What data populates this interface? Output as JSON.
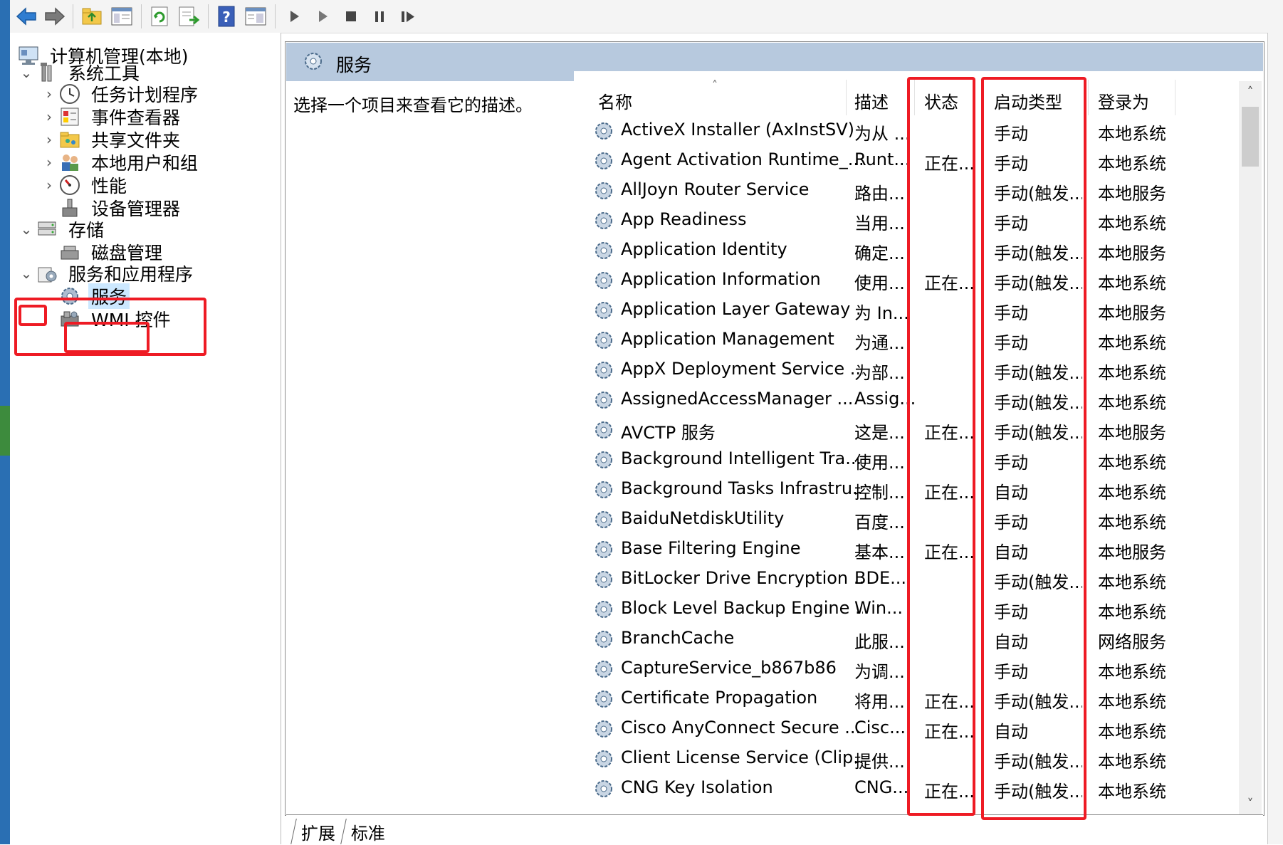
{
  "toolbar": {
    "buttons": [
      "back",
      "forward",
      "up-folder",
      "show-hide-tree",
      "refresh",
      "export-list",
      "help",
      "properties",
      "start-service",
      "start-service-alt",
      "stop-service",
      "pause-service",
      "resume-service"
    ]
  },
  "tree": {
    "root": "计算机管理(本地)",
    "system_tools": "系统工具",
    "task_scheduler": "任务计划程序",
    "event_viewer": "事件查看器",
    "shared_folders": "共享文件夹",
    "local_users": "本地用户和组",
    "performance": "性能",
    "device_manager": "设备管理器",
    "storage": "存储",
    "disk_management": "磁盘管理",
    "services_apps": "服务和应用程序",
    "services": "服务",
    "wmi": "WMI 控件"
  },
  "main": {
    "title": "服务",
    "description_hint": "选择一个项目来查看它的描述。",
    "columns": {
      "name": "名称",
      "description": "描述",
      "status": "状态",
      "startup_type": "启动类型",
      "logon_as": "登录为"
    },
    "rows": [
      {
        "name": "ActiveX Installer (AxInstSV)",
        "desc": "为从 ...",
        "status": "",
        "startup": "手动",
        "logon": "本地系统"
      },
      {
        "name": "Agent Activation Runtime_...",
        "desc": "Runt...",
        "status": "正在...",
        "startup": "手动",
        "logon": "本地系统"
      },
      {
        "name": "AllJoyn Router Service",
        "desc": "路由...",
        "status": "",
        "startup": "手动(触发...",
        "logon": "本地服务"
      },
      {
        "name": "App Readiness",
        "desc": "当用...",
        "status": "",
        "startup": "手动",
        "logon": "本地系统"
      },
      {
        "name": "Application Identity",
        "desc": "确定...",
        "status": "",
        "startup": "手动(触发...",
        "logon": "本地服务"
      },
      {
        "name": "Application Information",
        "desc": "使用...",
        "status": "正在...",
        "startup": "手动(触发...",
        "logon": "本地系统"
      },
      {
        "name": "Application Layer Gateway ...",
        "desc": "为 In...",
        "status": "",
        "startup": "手动",
        "logon": "本地服务"
      },
      {
        "name": "Application Management",
        "desc": "为通...",
        "status": "",
        "startup": "手动",
        "logon": "本地系统"
      },
      {
        "name": "AppX Deployment Service ...",
        "desc": "为部...",
        "status": "",
        "startup": "手动(触发...",
        "logon": "本地系统"
      },
      {
        "name": "AssignedAccessManager ...",
        "desc": "Assig...",
        "status": "",
        "startup": "手动(触发...",
        "logon": "本地系统"
      },
      {
        "name": "AVCTP 服务",
        "desc": "这是...",
        "status": "正在...",
        "startup": "手动(触发...",
        "logon": "本地服务"
      },
      {
        "name": "Background Intelligent Tra...",
        "desc": "使用...",
        "status": "",
        "startup": "手动",
        "logon": "本地系统"
      },
      {
        "name": "Background Tasks Infrastru...",
        "desc": "控制...",
        "status": "正在...",
        "startup": "自动",
        "logon": "本地系统"
      },
      {
        "name": "BaiduNetdiskUtility",
        "desc": "百度...",
        "status": "",
        "startup": "手动",
        "logon": "本地系统"
      },
      {
        "name": "Base Filtering Engine",
        "desc": "基本...",
        "status": "正在...",
        "startup": "自动",
        "logon": "本地服务"
      },
      {
        "name": "BitLocker Drive Encryption ...",
        "desc": "BDE...",
        "status": "",
        "startup": "手动(触发...",
        "logon": "本地系统"
      },
      {
        "name": "Block Level Backup Engine ...",
        "desc": "Win...",
        "status": "",
        "startup": "手动",
        "logon": "本地系统"
      },
      {
        "name": "BranchCache",
        "desc": "此服...",
        "status": "",
        "startup": "自动",
        "logon": "网络服务"
      },
      {
        "name": "CaptureService_b867b86",
        "desc": "为调...",
        "status": "",
        "startup": "手动",
        "logon": "本地系统"
      },
      {
        "name": "Certificate Propagation",
        "desc": "将用...",
        "status": "正在...",
        "startup": "手动(触发...",
        "logon": "本地系统"
      },
      {
        "name": "Cisco AnyConnect Secure ...",
        "desc": "Cisc...",
        "status": "正在...",
        "startup": "自动",
        "logon": "本地系统"
      },
      {
        "name": "Client License Service (Clip...",
        "desc": "提供...",
        "status": "",
        "startup": "手动(触发...",
        "logon": "本地系统"
      },
      {
        "name": "CNG Key Isolation",
        "desc": "CNG...",
        "status": "正在...",
        "startup": "手动(触发...",
        "logon": "本地系统"
      }
    ]
  },
  "tabs": {
    "extended": "扩展",
    "standard": "标准"
  },
  "colors": {
    "header_bg": "#b7c9de",
    "annotation_red": "#ee1b24",
    "selection_bg": "#cce8ff"
  }
}
